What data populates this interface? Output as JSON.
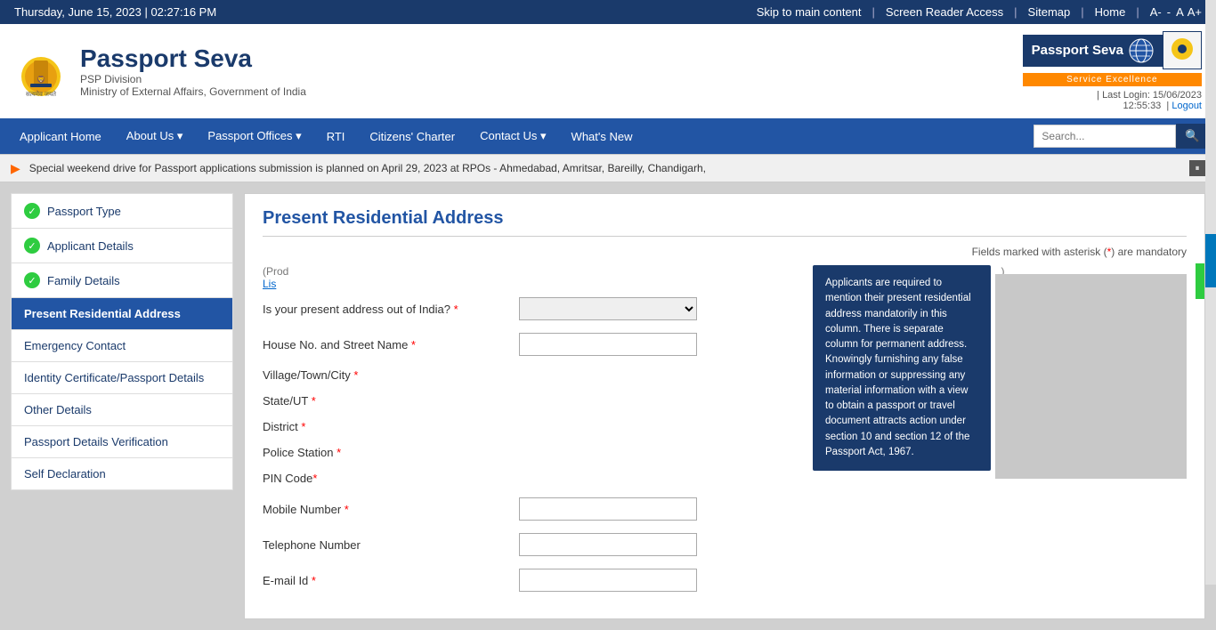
{
  "topbar": {
    "datetime": "Thursday,  June  15, 2023 | 02:27:16 PM",
    "skip": "Skip to main content",
    "screenreader": "Screen Reader Access",
    "sitemap": "Sitemap",
    "home": "Home",
    "font_a_small": "A-",
    "font_a": "A",
    "font_a_large": "A+"
  },
  "header": {
    "title": "Passport Seva",
    "division": "PSP Division",
    "ministry": "Ministry of External Affairs, Government of India",
    "brand_label": "Passport Seva",
    "service_label": "Service Excellence",
    "last_login_label": "Last Login: 15/06/2023",
    "last_login_time": "12:55:33",
    "logout": "Logout"
  },
  "nav": {
    "items": [
      {
        "label": "Applicant Home",
        "has_arrow": false
      },
      {
        "label": "About Us ▾",
        "has_arrow": false
      },
      {
        "label": "Passport Offices ▾",
        "has_arrow": false
      },
      {
        "label": "RTI",
        "has_arrow": false
      },
      {
        "label": "Citizens' Charter",
        "has_arrow": false
      },
      {
        "label": "Contact Us ▾",
        "has_arrow": false
      },
      {
        "label": "What's New",
        "has_arrow": false
      }
    ],
    "search_placeholder": "Search..."
  },
  "ticker": {
    "text": "Special weekend drive for Passport applications submission is planned on April 29, 2023 at RPOs - Ahmedabad, Amritsar, Bareilly, Chandigarh,"
  },
  "sidebar": {
    "items": [
      {
        "label": "Passport Type",
        "checked": true,
        "active": false
      },
      {
        "label": "Applicant Details",
        "checked": true,
        "active": false
      },
      {
        "label": "Family Details",
        "checked": true,
        "active": false
      },
      {
        "label": "Present Residential Address",
        "checked": false,
        "active": true
      },
      {
        "label": "Emergency Contact",
        "checked": false,
        "active": false
      },
      {
        "label": "Identity Certificate/Passport Details",
        "checked": false,
        "active": false
      },
      {
        "label": "Other Details",
        "checked": false,
        "active": false
      },
      {
        "label": "Passport Details Verification",
        "checked": false,
        "active": false
      },
      {
        "label": "Self Declaration",
        "checked": false,
        "active": false
      }
    ]
  },
  "form": {
    "title": "Present Residential Address",
    "mandatory_note": "Fields marked with asterisk (*) are mandatory",
    "prod_text_1": "(Prod",
    "prod_text_2": ")",
    "list_link": "Lis",
    "fields": [
      {
        "label": "Is your present address out of India?",
        "required": true,
        "type": "select"
      },
      {
        "label": "House No. and Street Name",
        "required": true,
        "type": "input"
      },
      {
        "label": "Village/Town/City",
        "required": true,
        "type": "input"
      },
      {
        "label": "State/UT",
        "required": true,
        "type": "input"
      },
      {
        "label": "District",
        "required": true,
        "type": "input"
      },
      {
        "label": "Police Station",
        "required": true,
        "type": "input"
      },
      {
        "label": "PIN Code",
        "required": true,
        "type": "input"
      },
      {
        "label": "Mobile Number",
        "required": true,
        "type": "input"
      },
      {
        "label": "Telephone Number",
        "required": false,
        "type": "input"
      },
      {
        "label": "E-mail Id",
        "required": true,
        "type": "input"
      }
    ]
  },
  "tooltip": {
    "text": "Applicants are required to mention their present residential address mandatorily in this column. There is separate column for permanent address. Knowingly furnishing any false information or suppressing any material information with a view to obtain a passport or travel document attracts action under section 10 and section 12 of the Passport Act, 1967."
  }
}
